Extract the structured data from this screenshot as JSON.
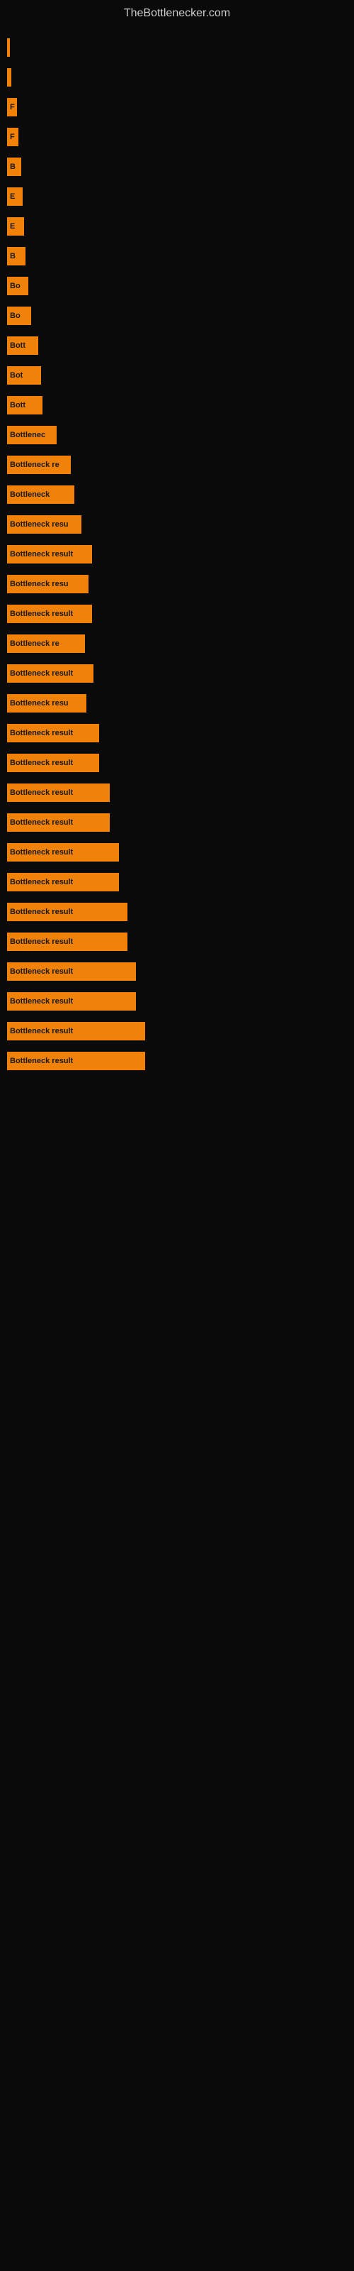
{
  "site": {
    "title": "TheBottlenecker.com"
  },
  "bars": [
    {
      "id": 1,
      "width": 4,
      "label": "",
      "labelOutside": ""
    },
    {
      "id": 2,
      "width": 6,
      "label": "",
      "labelOutside": ""
    },
    {
      "id": 3,
      "width": 14,
      "label": "F",
      "labelOutside": ""
    },
    {
      "id": 4,
      "width": 16,
      "label": "F",
      "labelOutside": ""
    },
    {
      "id": 5,
      "width": 20,
      "label": "B",
      "labelOutside": ""
    },
    {
      "id": 6,
      "width": 22,
      "label": "E",
      "labelOutside": ""
    },
    {
      "id": 7,
      "width": 24,
      "label": "E",
      "labelOutside": ""
    },
    {
      "id": 8,
      "width": 26,
      "label": "B",
      "labelOutside": ""
    },
    {
      "id": 9,
      "width": 30,
      "label": "Bo",
      "labelOutside": ""
    },
    {
      "id": 10,
      "width": 34,
      "label": "Bo",
      "labelOutside": ""
    },
    {
      "id": 11,
      "width": 44,
      "label": "Bott",
      "labelOutside": ""
    },
    {
      "id": 12,
      "width": 48,
      "label": "Bot",
      "labelOutside": ""
    },
    {
      "id": 13,
      "width": 50,
      "label": "Bott",
      "labelOutside": ""
    },
    {
      "id": 14,
      "width": 70,
      "label": "Bottlenec",
      "labelOutside": ""
    },
    {
      "id": 15,
      "width": 90,
      "label": "Bottleneck re",
      "labelOutside": ""
    },
    {
      "id": 16,
      "width": 95,
      "label": "Bottleneck",
      "labelOutside": ""
    },
    {
      "id": 17,
      "width": 105,
      "label": "Bottleneck resu",
      "labelOutside": ""
    },
    {
      "id": 18,
      "width": 120,
      "label": "Bottleneck result",
      "labelOutside": ""
    },
    {
      "id": 19,
      "width": 115,
      "label": "Bottleneck resu",
      "labelOutside": ""
    },
    {
      "id": 20,
      "width": 120,
      "label": "Bottleneck result",
      "labelOutside": ""
    },
    {
      "id": 21,
      "width": 110,
      "label": "Bottleneck re",
      "labelOutside": ""
    },
    {
      "id": 22,
      "width": 122,
      "label": "Bottleneck result",
      "labelOutside": ""
    },
    {
      "id": 23,
      "width": 112,
      "label": "Bottleneck resu",
      "labelOutside": ""
    },
    {
      "id": 24,
      "width": 130,
      "label": "Bottleneck result",
      "labelOutside": ""
    },
    {
      "id": 25,
      "width": 130,
      "label": "Bottleneck result",
      "labelOutside": ""
    },
    {
      "id": 26,
      "width": 145,
      "label": "Bottleneck result",
      "labelOutside": ""
    },
    {
      "id": 27,
      "width": 145,
      "label": "Bottleneck result",
      "labelOutside": ""
    },
    {
      "id": 28,
      "width": 158,
      "label": "Bottleneck result",
      "labelOutside": ""
    },
    {
      "id": 29,
      "width": 158,
      "label": "Bottleneck result",
      "labelOutside": ""
    },
    {
      "id": 30,
      "width": 170,
      "label": "Bottleneck result",
      "labelOutside": ""
    },
    {
      "id": 31,
      "width": 170,
      "label": "Bottleneck result",
      "labelOutside": ""
    },
    {
      "id": 32,
      "width": 182,
      "label": "Bottleneck result",
      "labelOutside": ""
    },
    {
      "id": 33,
      "width": 182,
      "label": "Bottleneck result",
      "labelOutside": ""
    },
    {
      "id": 34,
      "width": 195,
      "label": "Bottleneck result",
      "labelOutside": ""
    },
    {
      "id": 35,
      "width": 195,
      "label": "Bottleneck result",
      "labelOutside": ""
    }
  ]
}
